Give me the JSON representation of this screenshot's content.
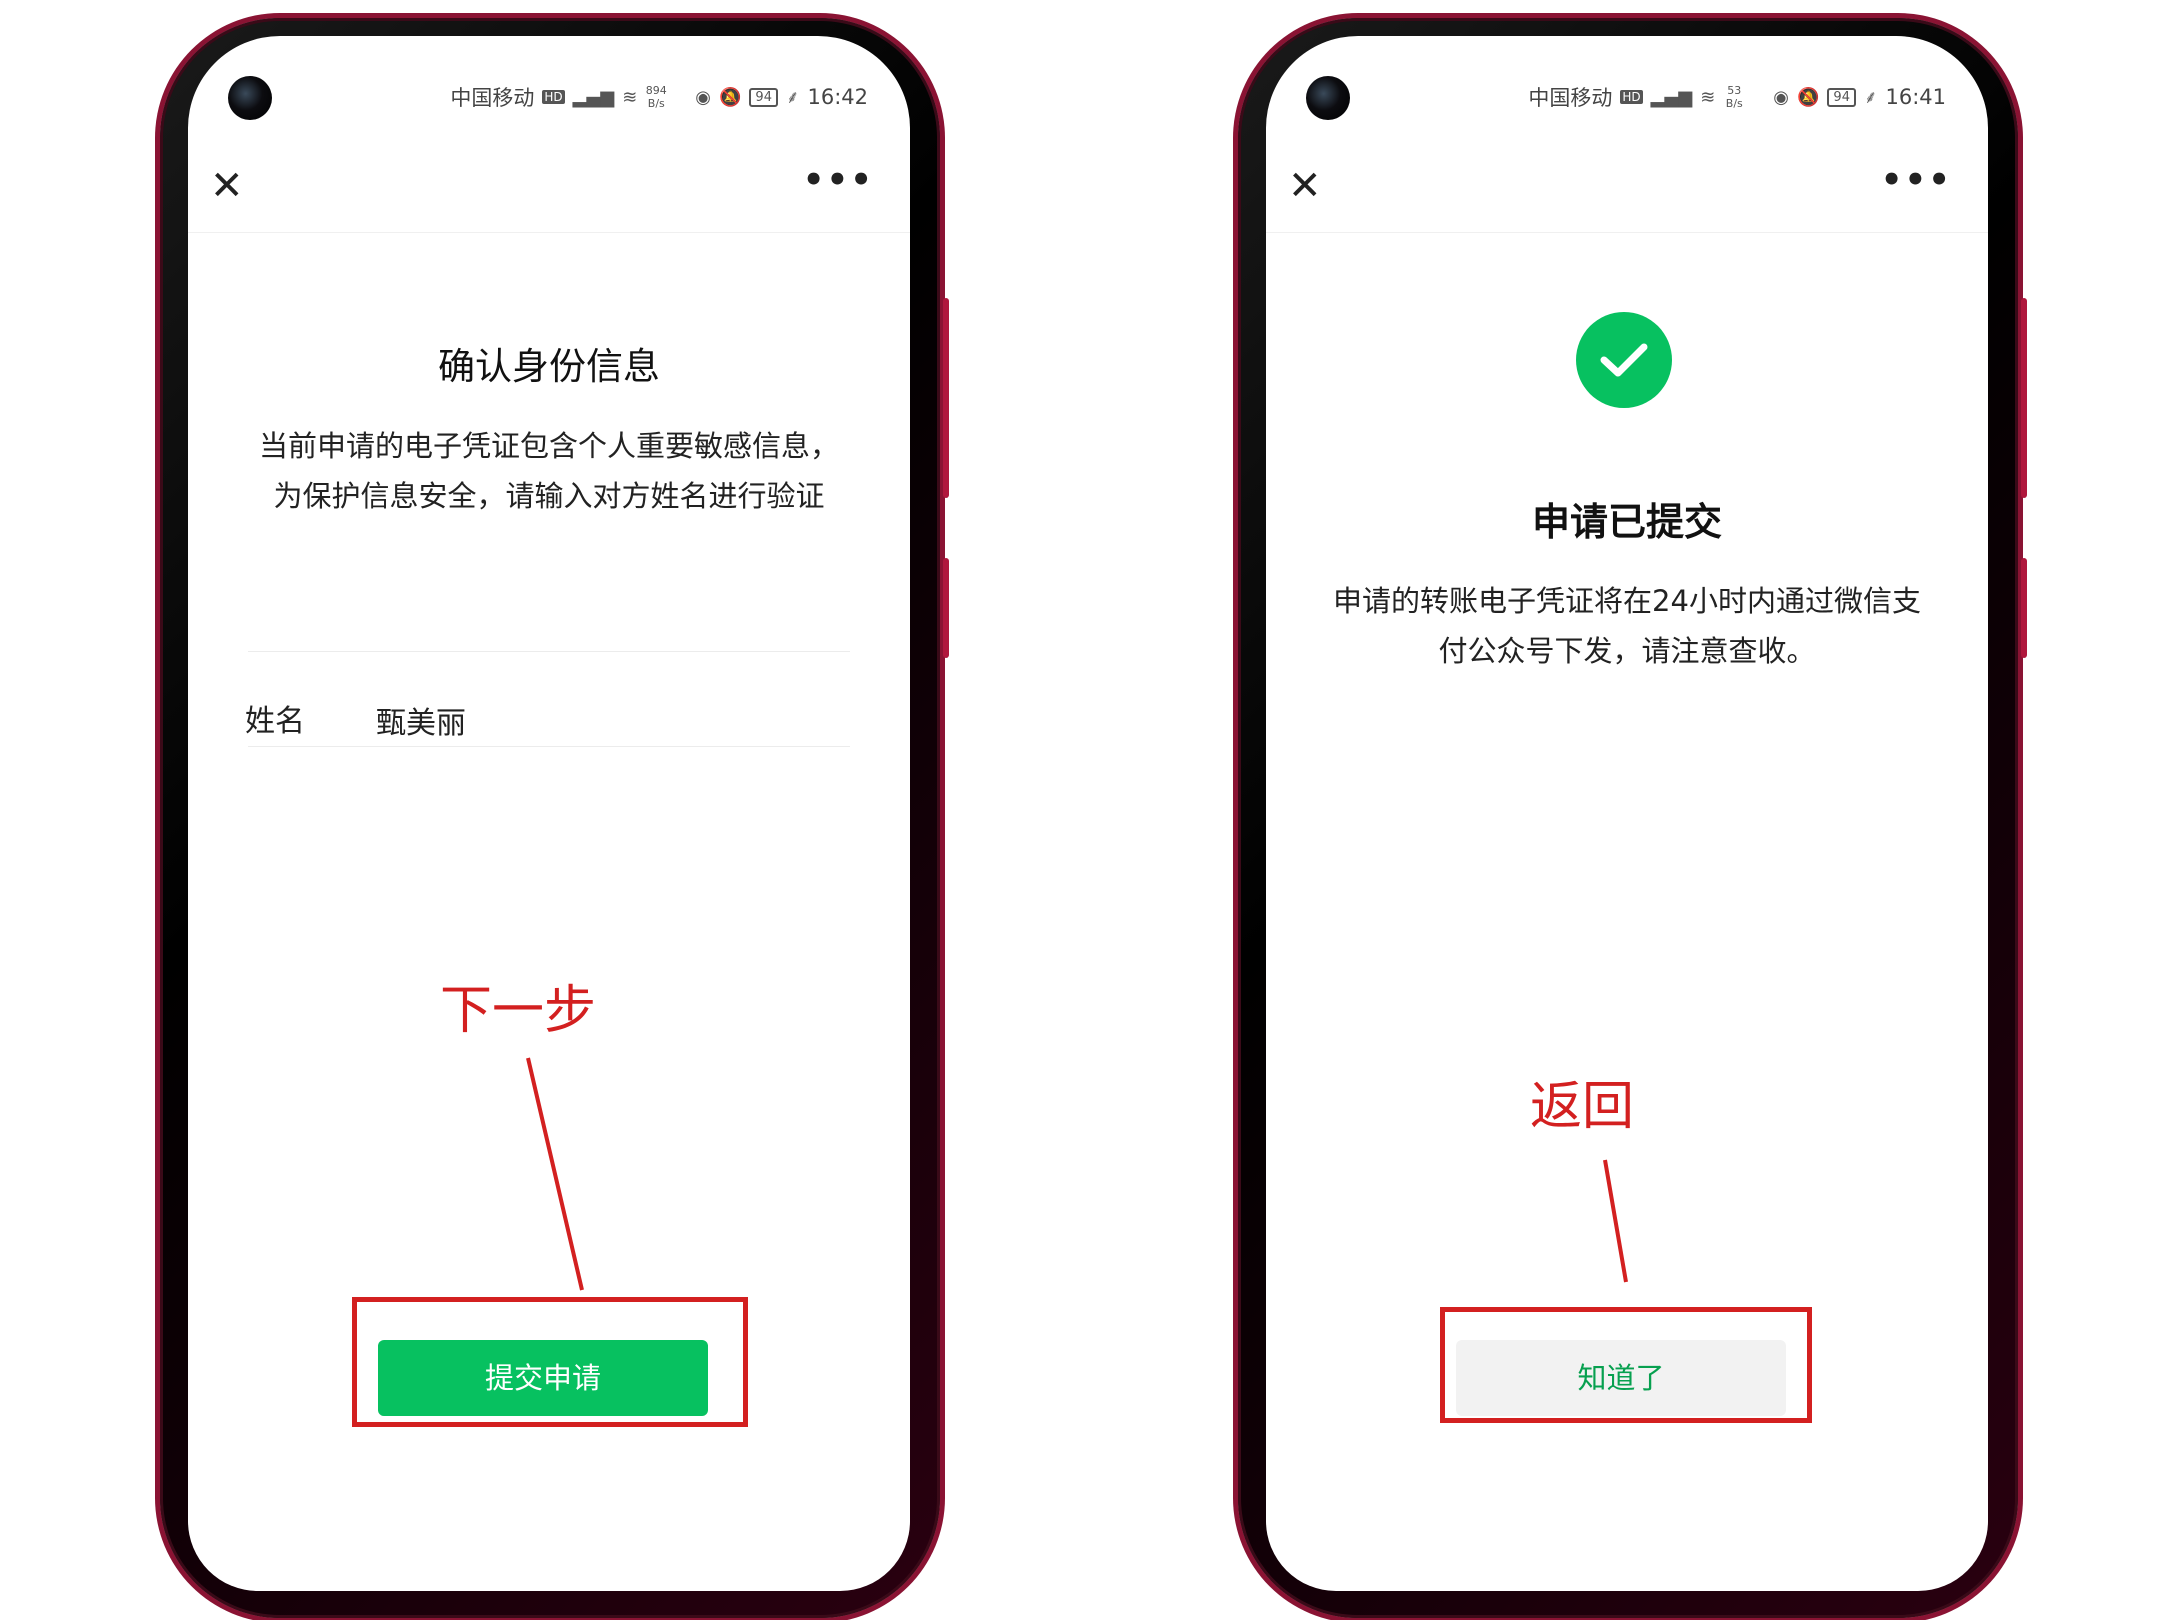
{
  "left_screen": {
    "status": {
      "carrier": "中国移动",
      "hd": "HD",
      "net_speed_value": "894",
      "net_speed_unit": "B/s",
      "battery": "94",
      "time": "16:42"
    },
    "nav": {
      "close_icon": "close-icon",
      "more_icon": "more-icon"
    },
    "title": "确认身份信息",
    "description": "当前申请的电子凭证包含个人重要敏感信息，为保护信息安全，请输入对方姓名进行验证",
    "name_field": {
      "label": "姓名",
      "value": "甄美丽"
    },
    "submit_button": "提交申请"
  },
  "right_screen": {
    "status": {
      "carrier": "中国移动",
      "hd": "HD",
      "net_speed_value": "53",
      "net_speed_unit": "B/s",
      "battery": "94",
      "time": "16:41"
    },
    "nav": {
      "close_icon": "close-icon",
      "more_icon": "more-icon"
    },
    "success_icon": "check-circle-icon",
    "title": "申请已提交",
    "description": "申请的转账电子凭证将在24小时内通过微信支付公众号下发，请注意查收。",
    "ok_button": "知道了"
  },
  "annotations": {
    "left_label": "下一步",
    "right_label": "返回",
    "color": "#d32020"
  },
  "colors": {
    "wechat_green": "#07c160",
    "frame_red": "#8a1333"
  }
}
